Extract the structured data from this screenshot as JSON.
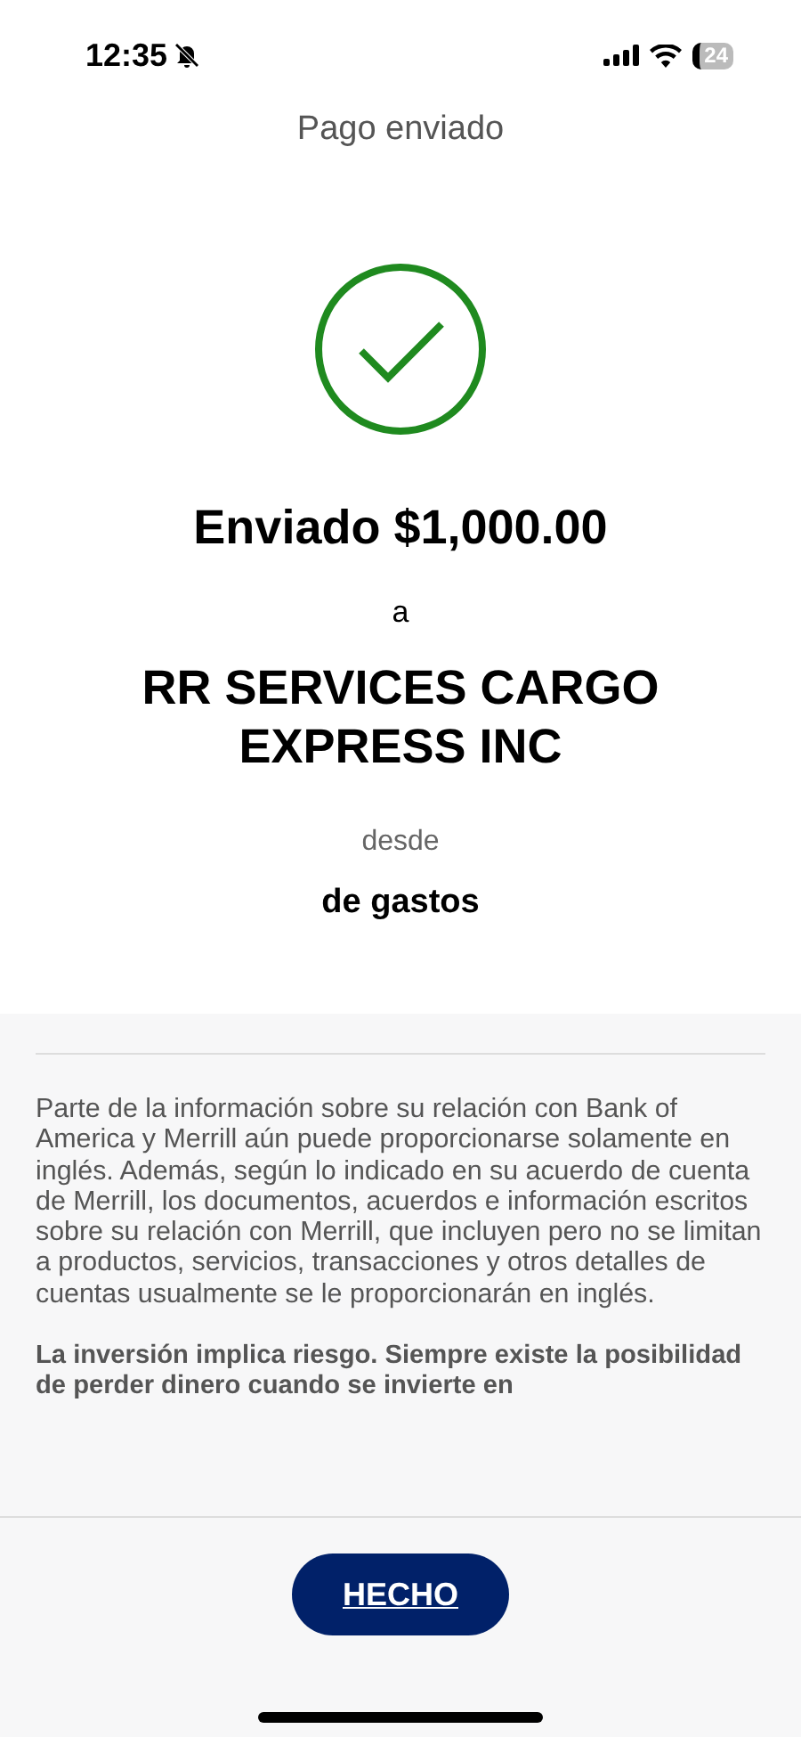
{
  "status_bar": {
    "time": "12:35",
    "silent": true,
    "battery": "24"
  },
  "header": {
    "title": "Pago enviado"
  },
  "confirmation": {
    "headline": "Enviado $1,000.00",
    "to_label": "a",
    "recipient": "RR SERVICES CARGO EXPRESS INC",
    "from_label": "desde",
    "account": "de gastos"
  },
  "disclosures": [
    {
      "kind": "normal",
      "text": "Parte de la información sobre su relación con Bank of America y Merrill aún puede proporcionarse solamente en inglés. Además, según lo indicado en su acuerdo de cuenta de Merrill, los documentos, acuerdos e información escritos sobre su relación con Merrill, que incluyen pero no se limitan a productos, servicios, transacciones y otros detalles de cuentas usualmente se le proporcionarán en inglés."
    },
    {
      "kind": "bold",
      "text": "La inversión implica riesgo. Siempre existe la posibilidad de perder dinero cuando se invierte en"
    }
  ],
  "done_button": {
    "label": "HECHO"
  }
}
